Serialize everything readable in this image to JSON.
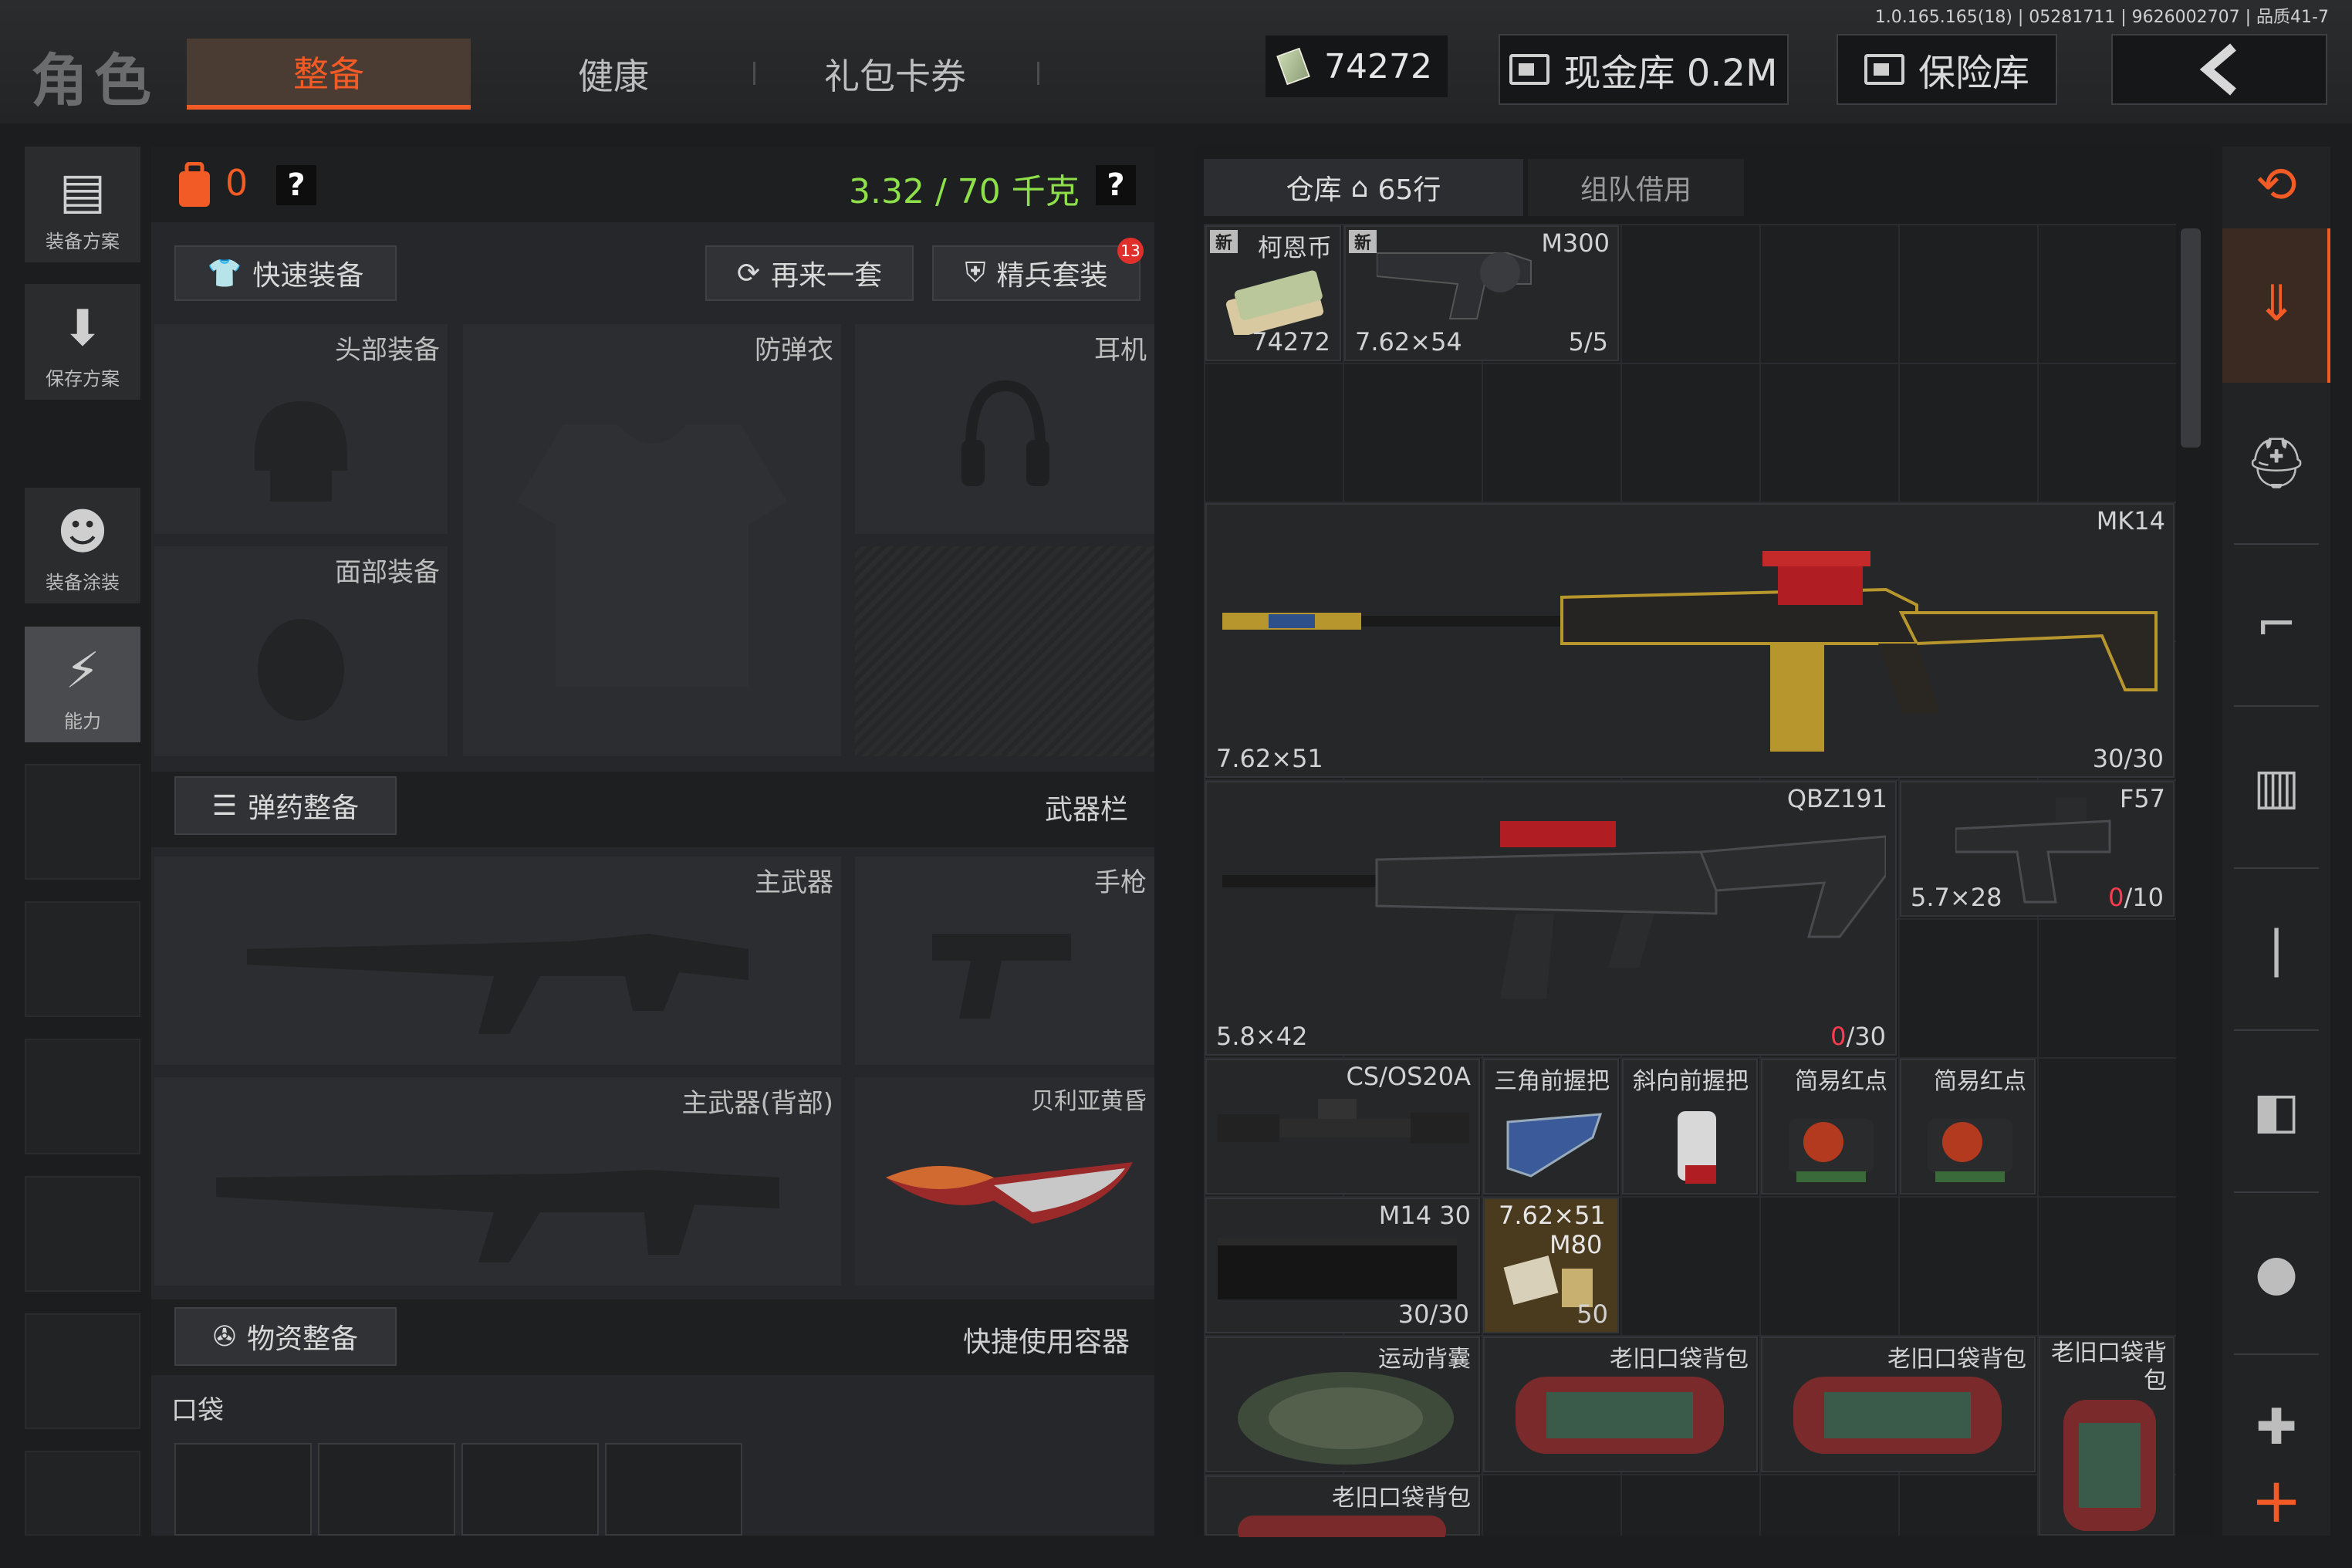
{
  "version_info": "1.0.165.165(18) | 05281711 | 9626002707 | 品质41-7",
  "header": {
    "title": "角色",
    "tabs": [
      {
        "label": "整备",
        "active": true
      },
      {
        "label": "健康",
        "active": false
      },
      {
        "label": "礼包卡券",
        "active": false
      }
    ],
    "currency_value": "74272",
    "cash_vault_label": "现金库 0.2M",
    "safe_label": "保险库",
    "back_icon": "chevron-left-icon"
  },
  "left_rail": [
    {
      "label": "装备方案",
      "icon": "vest-icon"
    },
    {
      "label": "保存方案",
      "icon": "download-arrow-icon"
    },
    {
      "label": "装备涂装",
      "icon": "soldier-mask-icon"
    },
    {
      "label": "能力",
      "icon": "ability-bolt-icon"
    }
  ],
  "loadout": {
    "backpack_count": "0",
    "help": "?",
    "weight": "3.32 / 70 千克",
    "quick_equip": "快速装备",
    "again_set": "再来一套",
    "elite_set": "精兵套装",
    "elite_badge": "13",
    "slots": {
      "head": "头部装备",
      "armor": "防弹衣",
      "ear": "耳机",
      "face": "面部装备"
    },
    "ammo_btn": "弹药整备",
    "weapon_bar": "武器栏",
    "primary": "主武器",
    "pistol": "手枪",
    "primary_back": "主武器(背部)",
    "melee": "贝利亚黄昏",
    "supply_btn": "物资整备",
    "quick_container": "快捷使用容器",
    "pocket": "口袋"
  },
  "inventory": {
    "tab_warehouse": "仓库",
    "rows": "65行",
    "tab_team": "组队借用",
    "items": {
      "coin": {
        "name": "柯恩币",
        "count": "74272",
        "tag": "新"
      },
      "m300": {
        "name": "M300",
        "caliber": "7.62×54",
        "ammo": "5/5",
        "tag": "新"
      },
      "mk14": {
        "name": "MK14",
        "caliber": "7.62×51",
        "ammo": "30/30"
      },
      "qbz": {
        "name": "QBZ191",
        "caliber": "5.8×42",
        "ammo_cur": "0",
        "ammo_max": "/30"
      },
      "f57": {
        "name": "F57",
        "caliber": "5.7×28",
        "ammo_cur": "0",
        "ammo_max": "/10"
      },
      "scope": {
        "name": "CS/OS20A"
      },
      "grip1": {
        "name": "三角前握把"
      },
      "grip2": {
        "name": "斜向前握把"
      },
      "reddot1": {
        "name": "简易红点"
      },
      "reddot2": {
        "name": "简易红点"
      },
      "mag": {
        "name": "M14 30",
        "ammo": "30/30"
      },
      "ammo": {
        "name": "7.62×51",
        "sub": "M80",
        "count": "50"
      },
      "bag1": {
        "name": "运动背囊"
      },
      "bag2": {
        "name": "老旧口袋背包"
      },
      "bag3": {
        "name": "老旧口袋背包"
      },
      "bag4": {
        "name": "老旧口袋背包"
      },
      "bag5": {
        "name": "老旧口袋背包"
      }
    }
  },
  "right_rail": [
    "stack-refresh-icon",
    "stack-download-icon",
    "helmet-icon",
    "rifle-icon",
    "magazine-icon",
    "bullet-icon",
    "sight-icon",
    "grenade-icon",
    "medkit-icon",
    "plus-icon"
  ],
  "colors": {
    "accent": "#f25b25",
    "weight_green": "#8ee04a",
    "ammo_red": "#ff3b4f"
  }
}
